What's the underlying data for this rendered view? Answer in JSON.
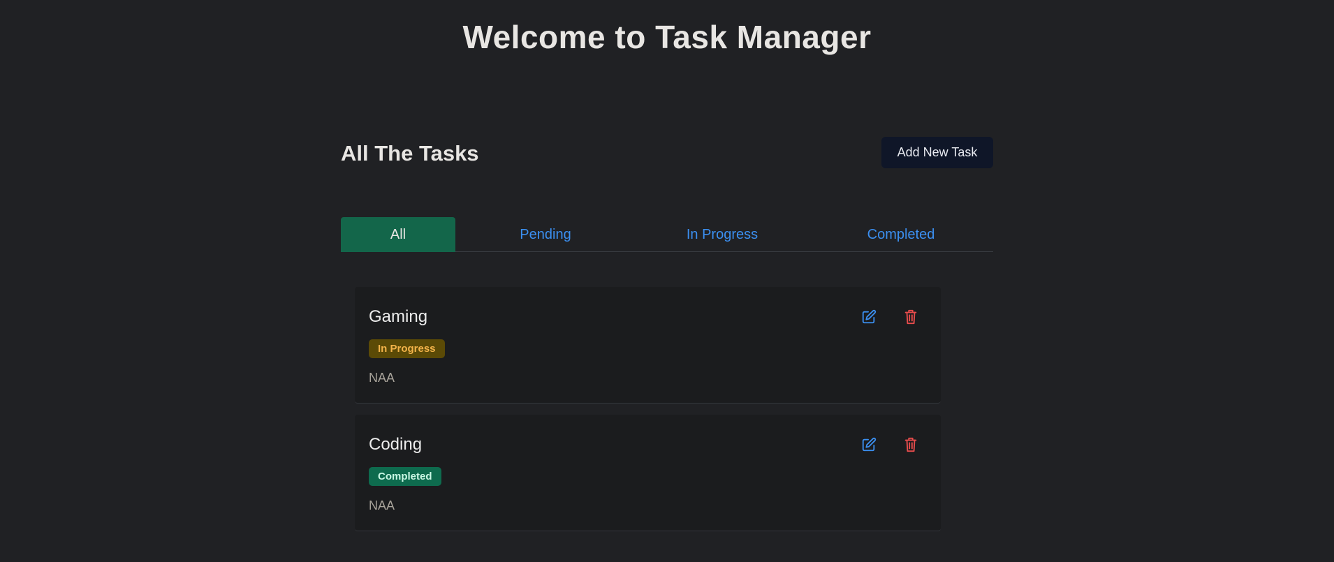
{
  "header": {
    "title": "Welcome to Task Manager"
  },
  "main": {
    "section_title": "All The Tasks",
    "add_button_label": "Add New Task"
  },
  "tabs": [
    {
      "label": "All",
      "active": true
    },
    {
      "label": "Pending",
      "active": false
    },
    {
      "label": "In Progress",
      "active": false
    },
    {
      "label": "Completed",
      "active": false
    }
  ],
  "tasks": [
    {
      "title": "Gaming",
      "status": "In Progress",
      "description": "NAA"
    },
    {
      "title": "Coding",
      "status": "Completed",
      "description": "NAA"
    }
  ],
  "icons": {
    "edit": "edit-icon",
    "delete": "trash-icon"
  },
  "colors": {
    "background": "#202124",
    "active_tab": "#13664a",
    "link_blue": "#3b8ff0",
    "delete_red": "#e84c4c",
    "badge_in_progress_bg": "#5b4a06",
    "badge_completed_bg": "#0e6b4e"
  }
}
